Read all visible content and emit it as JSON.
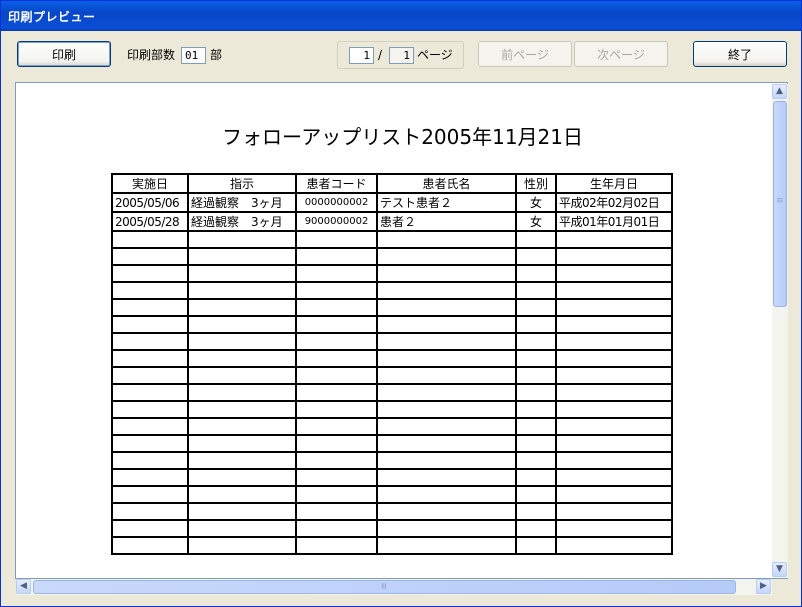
{
  "window": {
    "title": "印刷プレビュー"
  },
  "toolbar": {
    "print_label": "印刷",
    "copies_label": "印刷部数",
    "copies_value": "01",
    "copies_suffix": "部",
    "page_current": "1",
    "page_separator": "/",
    "page_total": "1",
    "page_suffix": "ページ",
    "prev_label": "前ページ",
    "next_label": "次ページ",
    "close_label": "終了"
  },
  "document": {
    "title": "フォローアップリスト2005年11月21日",
    "columns": [
      "実施日",
      "指示",
      "患者コード",
      "患者氏名",
      "性別",
      "生年月日"
    ],
    "rows": [
      [
        "2005/05/06",
        "経過観察　3ヶ月",
        "0000000002",
        "テスト患者２",
        "女",
        "平成02年02月02日"
      ],
      [
        "2005/05/28",
        "経過観察　3ヶ月",
        "9000000002",
        "患者２",
        "女",
        "平成01年01月01日"
      ]
    ],
    "empty_rows": 19
  },
  "scrollbars": {
    "up_icon": "▲",
    "down_icon": "▼",
    "left_icon": "◀",
    "right_icon": "▶",
    "grip": "≡"
  }
}
